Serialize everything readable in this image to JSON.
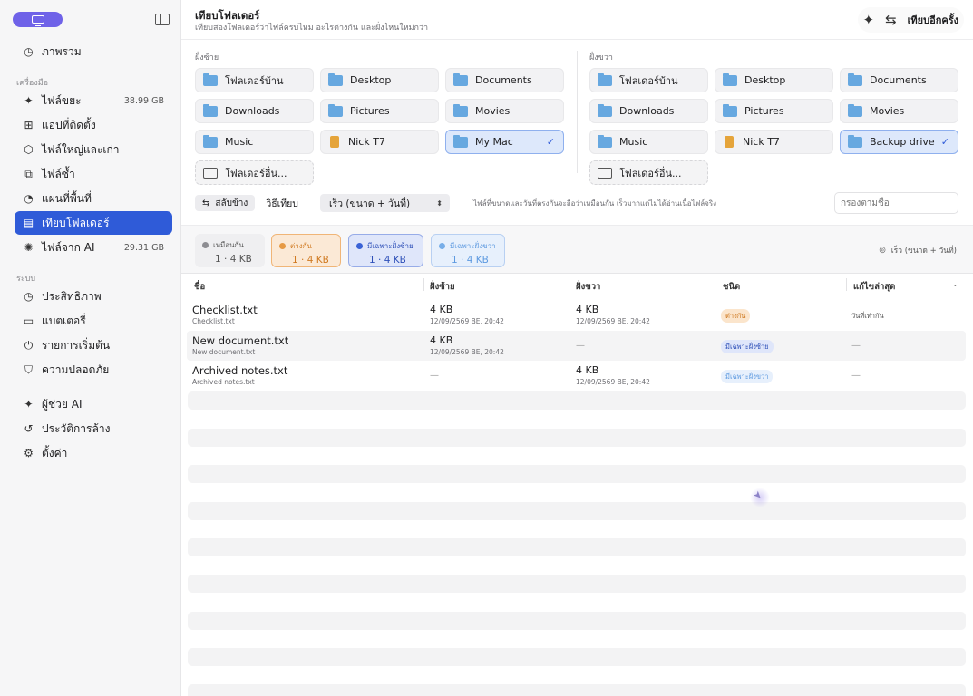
{
  "sidebar": {
    "section_device": "เครื่องมือ",
    "section_system": "ระบบ",
    "items": [
      {
        "label": "ภาพรวม",
        "size": ""
      },
      {
        "label": "ไฟล์ขยะ",
        "size": "38.99 GB"
      },
      {
        "label": "แอปที่ติดตั้ง",
        "size": ""
      },
      {
        "label": "ไฟล์ใหญ่และเก่า",
        "size": ""
      },
      {
        "label": "ไฟล์ซ้ำ",
        "size": ""
      },
      {
        "label": "แผนที่พื้นที่",
        "size": ""
      },
      {
        "label": "เทียบโฟลเดอร์",
        "size": ""
      },
      {
        "label": "ไฟล์จาก AI",
        "size": "29.31 GB"
      },
      {
        "label": "ประสิทธิภาพ",
        "size": ""
      },
      {
        "label": "แบตเตอรี่",
        "size": ""
      },
      {
        "label": "รายการเริ่มต้น",
        "size": ""
      },
      {
        "label": "ความปลอดภัย",
        "size": ""
      },
      {
        "label": "ผู้ช่วย AI",
        "size": ""
      },
      {
        "label": "ประวัติการล้าง",
        "size": ""
      },
      {
        "label": "ตั้งค่า",
        "size": ""
      }
    ]
  },
  "header": {
    "title": "เทียบโฟลเดอร์",
    "subtitle": "เทียบสองโฟลเดอร์ว่าไฟล์ครบไหม อะไรต่างกัน และฝั่งไหนใหม่กว่า",
    "compare_again": "เทียบอีกครั้ง"
  },
  "left_pane": {
    "label": "ฝั่งซ้าย",
    "folders": [
      "โฟลเดอร์บ้าน",
      "Desktop",
      "Documents",
      "Downloads",
      "Pictures",
      "Movies",
      "Music",
      "Nick T7",
      "My Mac"
    ],
    "other": "โฟลเดอร์อื่น..."
  },
  "right_pane": {
    "label": "ฝั่งขวา",
    "folders": [
      "โฟลเดอร์บ้าน",
      "Desktop",
      "Documents",
      "Downloads",
      "Pictures",
      "Movies",
      "Music",
      "Nick T7",
      "Backup drive"
    ],
    "other": "โฟลเดอร์อื่น..."
  },
  "controls": {
    "swap_label": "สลับข้าง",
    "method_label": "วิธีเทียบ",
    "method_value": "เร็ว (ขนาด + วันที่)",
    "hint": "ไฟล์ที่ขนาดและวันที่ตรงกันจะถือว่าเหมือนกัน เร็วมากแต่ไม่ได้อ่านเนื้อไฟล์จริง",
    "filter_placeholder": "กรองตามชื่อ"
  },
  "summary": {
    "same": {
      "label": "เหมือนกัน",
      "value": "1 · 4 KB"
    },
    "diff": {
      "label": "ต่างกัน",
      "value": "1 · 4 KB"
    },
    "left_only": {
      "label": "มีเฉพาะฝั่งซ้าย",
      "value": "1 · 4 KB"
    },
    "right_only": {
      "label": "มีเฉพาะฝั่งขวา",
      "value": "1 · 4 KB"
    },
    "mode_note": "เร็ว (ขนาด + วันที่)"
  },
  "table": {
    "headers": [
      "ชื่อ",
      "ฝั่งซ้าย",
      "ฝั่งขวา",
      "ชนิด",
      "แก้ไขล่าสุด"
    ],
    "rows": [
      {
        "name": "Checklist.txt",
        "sub": "Checklist.txt",
        "left_size": "4 KB",
        "left_date": "12/09/2569 BE, 20:42",
        "right_size": "4 KB",
        "right_date": "12/09/2569 BE, 20:42",
        "kind": "ต่างกัน",
        "latest": "วันที่เท่ากัน"
      },
      {
        "name": "New document.txt",
        "sub": "New document.txt",
        "left_size": "4 KB",
        "left_date": "12/09/2569 BE, 20:42",
        "right_dash": "—",
        "kind": "มีเฉพาะฝั่งซ้าย",
        "latest": "—"
      },
      {
        "name": "Archived notes.txt",
        "sub": "Archived notes.txt",
        "left_dash": "—",
        "right_size": "4 KB",
        "right_date": "12/09/2569 BE, 20:42",
        "kind": "มีเฉพาะฝั่งขวา",
        "latest": "—"
      }
    ]
  },
  "colors": {
    "accent": "#2f5bd8",
    "brand_pill": "#6f62e8",
    "diff": "#e69a45",
    "left_only": "#3a63d6",
    "right_only": "#78aee8"
  }
}
